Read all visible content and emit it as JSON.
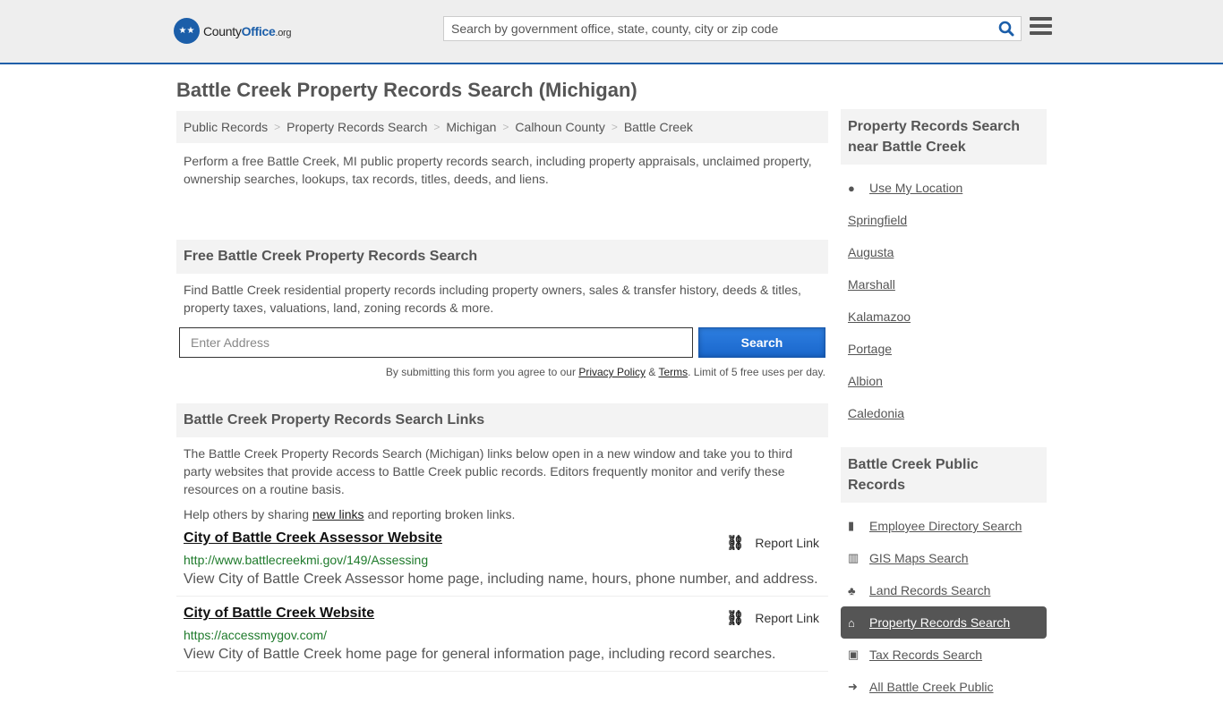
{
  "header": {
    "logo_prefix": "County",
    "logo_office": "Office",
    "logo_suffix": ".org",
    "search_placeholder": "Search by government office, state, county, city or zip code"
  },
  "page_title": "Battle Creek Property Records Search (Michigan)",
  "breadcrumb": [
    "Public Records",
    "Property Records Search",
    "Michigan",
    "Calhoun County",
    "Battle Creek"
  ],
  "intro": "Perform a free Battle Creek, MI public property records search, including property appraisals, unclaimed property, ownership searches, lookups, tax records, titles, deeds, and liens.",
  "search_section": {
    "heading": "Free Battle Creek Property Records Search",
    "description": "Find Battle Creek residential property records including property owners, sales & transfer history, deeds & titles, property taxes, valuations, land, zoning records & more.",
    "address_placeholder": "Enter Address",
    "button_label": "Search",
    "terms_prefix": "By submitting this form you agree to our ",
    "privacy_label": "Privacy Policy",
    "terms_amp": " & ",
    "terms_label": "Terms",
    "terms_suffix": ". Limit of 5 free uses per day."
  },
  "links_section": {
    "heading": "Battle Creek Property Records Search Links",
    "description": "The Battle Creek Property Records Search (Michigan) links below open in a new window and take you to third party websites that provide access to Battle Creek public records. Editors frequently monitor and verify these resources on a routine basis.",
    "help_prefix": "Help others by sharing ",
    "help_link": "new links",
    "help_suffix": " and reporting broken links.",
    "report_label": "Report Link",
    "items": [
      {
        "title": "City of Battle Creek Assessor Website",
        "url": "http://www.battlecreekmi.gov/149/Assessing",
        "description": "View City of Battle Creek Assessor home page, including name, hours, phone number, and address."
      },
      {
        "title": "City of Battle Creek Website",
        "url": "https://accessmygov.com/",
        "description": "View City of Battle Creek home page for general information page, including record searches."
      }
    ]
  },
  "sidebar": {
    "nearby_heading": "Property Records Search near Battle Creek",
    "use_location": "Use My Location",
    "nearby": [
      "Springfield",
      "Augusta",
      "Marshall",
      "Kalamazoo",
      "Portage",
      "Albion",
      "Caledonia"
    ],
    "public_heading": "Battle Creek Public Records",
    "public_items": [
      {
        "label": "Employee Directory Search",
        "icon": "book-icon",
        "active": false
      },
      {
        "label": "GIS Maps Search",
        "icon": "map-icon",
        "active": false
      },
      {
        "label": "Land Records Search",
        "icon": "tree-icon",
        "active": false
      },
      {
        "label": "Property Records Search",
        "icon": "home-icon",
        "active": true
      },
      {
        "label": "Tax Records Search",
        "icon": "money-icon",
        "active": false
      },
      {
        "label": "All Battle Creek Public",
        "icon": "arrow-right-icon",
        "active": false
      }
    ]
  }
}
